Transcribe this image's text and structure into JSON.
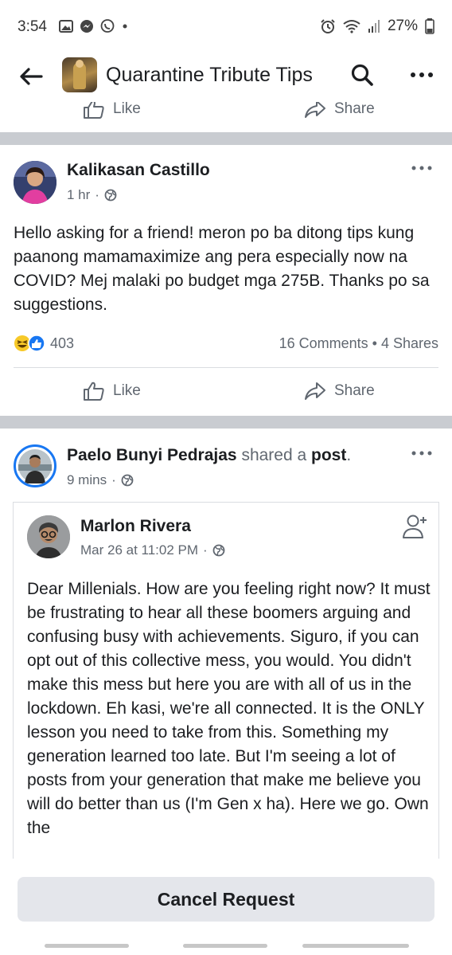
{
  "status_bar": {
    "time": "3:54",
    "battery": "27%",
    "left_icons": [
      "gallery-icon",
      "messenger-icon",
      "viber-icon",
      "dot-icon"
    ],
    "right_icons": [
      "alarm-icon",
      "wifi-icon",
      "signal-icon",
      "battery-icon"
    ]
  },
  "header": {
    "title": "Quarantine Tribute Tips"
  },
  "prev_post_actions": {
    "like_label": "Like",
    "share_label": "Share"
  },
  "post1": {
    "author": "Kalikasan Castillo",
    "time": "1 hr",
    "body": "Hello asking for a friend! meron po ba ditong tips kung paanong mamamaximize ang pera especially now na COVID? Mej malaki po budget mga 275B. Thanks po sa suggestions.",
    "reaction_count": "403",
    "comments_shares": "16 Comments • 4 Shares",
    "like_label": "Like",
    "share_label": "Share"
  },
  "post2": {
    "author": "Paelo Bunyi Pedrajas",
    "shared_text": "shared a",
    "post_word": "post",
    "period": ".",
    "time": "9 mins",
    "shared": {
      "author": "Marlon Rivera",
      "time": "Mar 26 at 11:02 PM",
      "body": "Dear Millenials. How are you feeling right now? It must be frustrating to hear all these boomers arguing and confusing busy with achievements. Siguro, if you can opt out of this collective mess, you would. You didn't make this mess but here you are with all of us in the lockdown. Eh kasi, we're all connected. It is the ONLY lesson you need to take from this. Something my generation learned too late. But I'm  seeing a lot of posts from your generation that make me believe you will do better than us (I'm Gen x ha). Here we go. Own the"
    }
  },
  "bottom": {
    "cancel_label": "Cancel Request"
  },
  "colors": {
    "text": "#1c1e21",
    "muted": "#606770",
    "divider": "#c9ccd1",
    "button_bg": "#e4e6eb",
    "like_blue": "#1877f2",
    "haha_yellow": "#f7c928"
  }
}
